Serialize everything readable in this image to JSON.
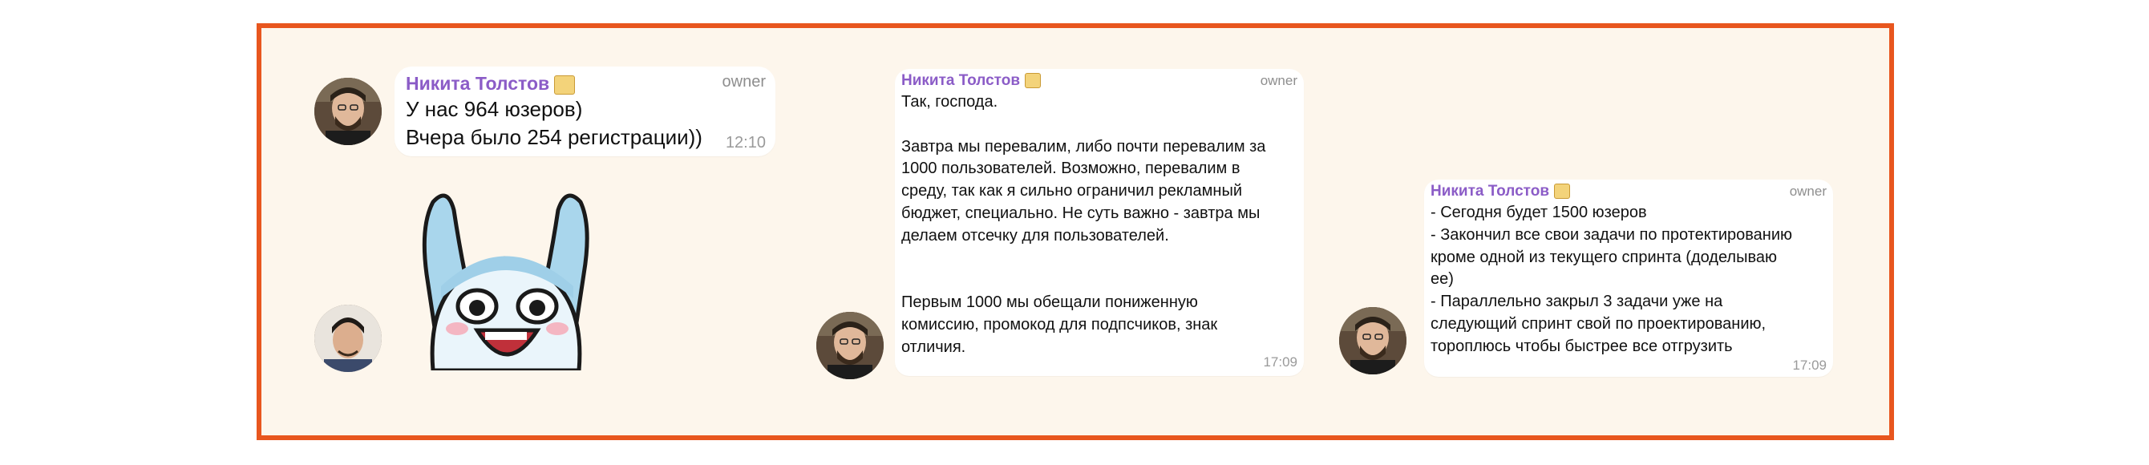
{
  "author": {
    "name": "Никита Толстов",
    "role": "owner",
    "badge_icon": "emoji-badge-icon"
  },
  "message1": {
    "lines": [
      "У нас 964 юзеров)",
      "Вчера было 254 регистрации))"
    ],
    "time": "12:10"
  },
  "message2": {
    "lines": [
      "Так, господа.",
      "",
      "Завтра мы перевалим, либо почти перевалим за",
      "1000 пользователей. Возможно, перевалим в",
      "среду, так как я сильно ограничил рекламный",
      "бюджет, специально. Не суть важно - завтра мы",
      "делаем отсечку для пользователей.",
      "",
      "",
      "Первым 1000 мы обещали пониженную",
      "комиссию, промокод для подпсчиков, знак",
      "отличия."
    ],
    "time": "17:09"
  },
  "message3": {
    "lines": [
      "- Сегодня будет 1500 юзеров",
      "- Закончил все свои задачи по протектированию",
      "кроме одной из текущего спринта (доделываю",
      "ее)",
      "- Параллельно закрыл 3 задачи уже на",
      "следующий спринт свой по проектированию,",
      "тороплюсь чтобы быстрее все отгрузить"
    ],
    "time": "17:09"
  },
  "colors": {
    "frame": "#e8561e",
    "background": "#fdf6ec",
    "name": "#8b5cc7"
  }
}
